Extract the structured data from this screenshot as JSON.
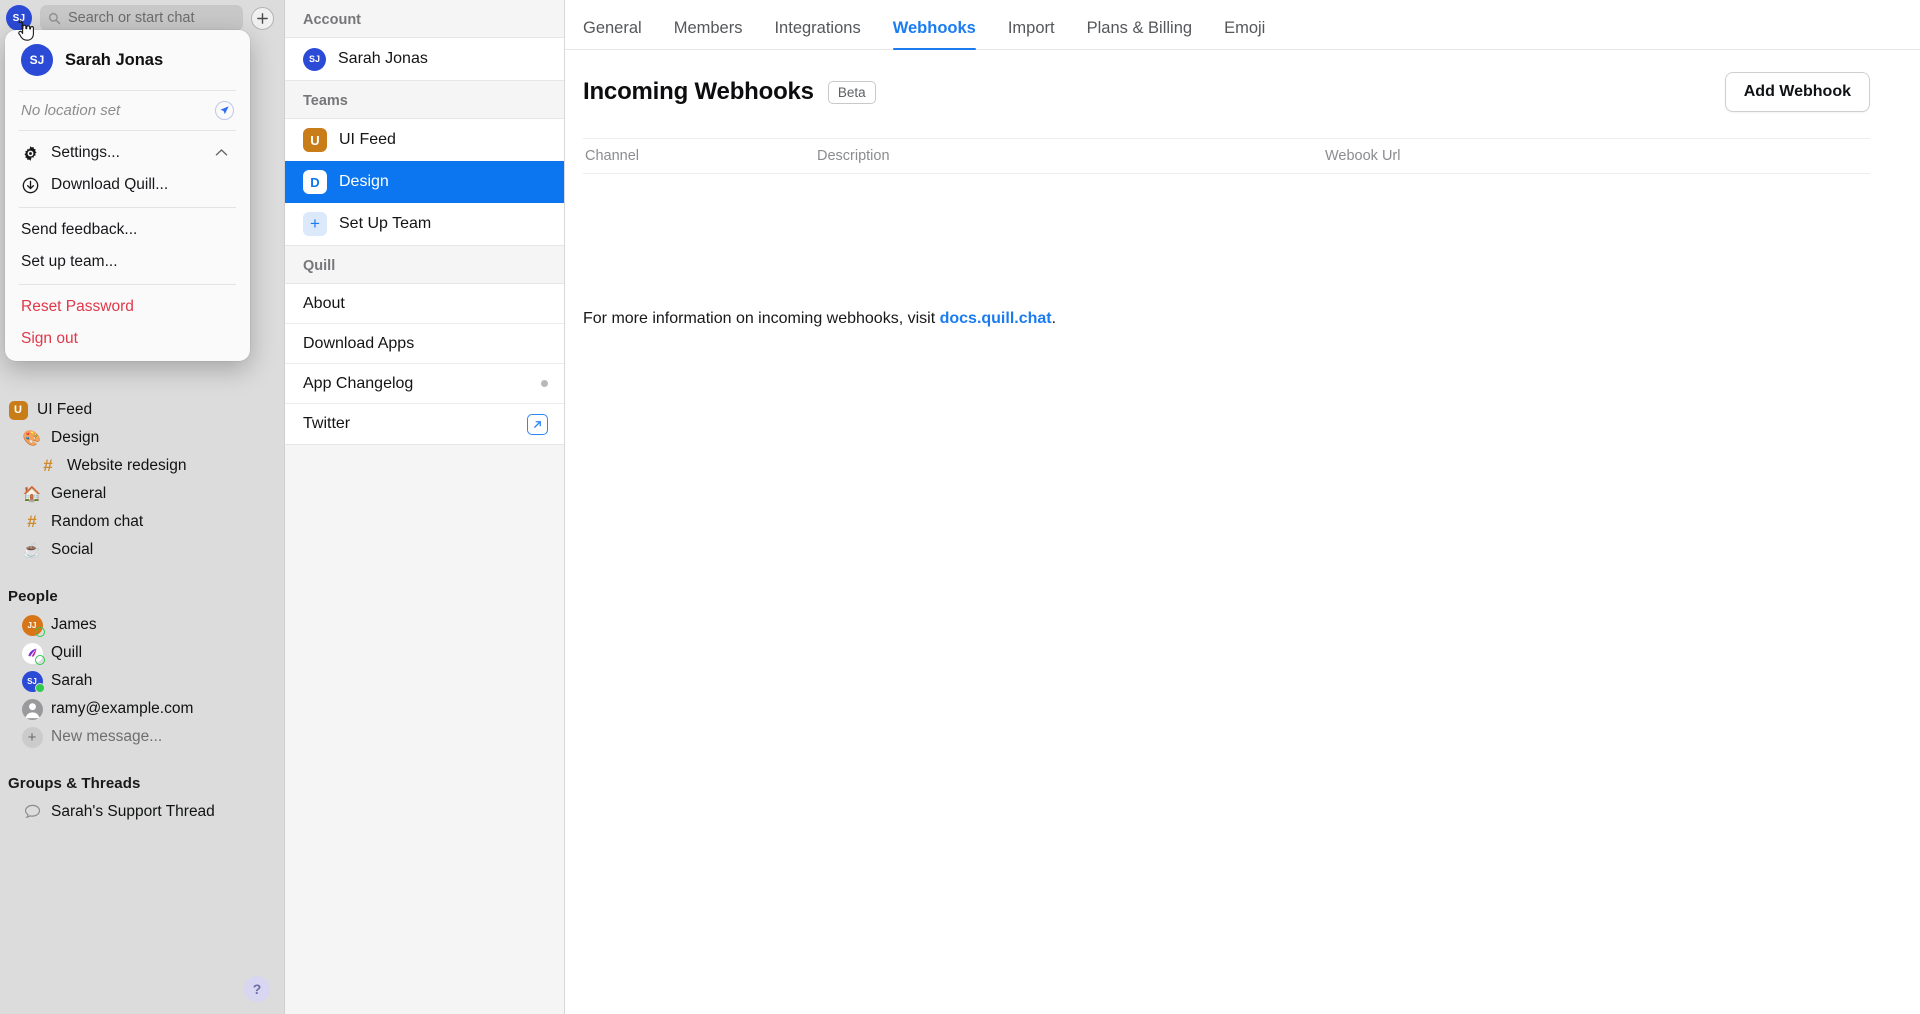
{
  "sidebar": {
    "avatar_initials": "SJ",
    "search": {
      "placeholder": "Search or start chat",
      "icon": "search-icon"
    },
    "new_chat_icon": "plus-icon",
    "teams": [
      {
        "label": "UI Feed",
        "badge": "U",
        "kind": "team"
      },
      {
        "label": "Design",
        "icon": "palette",
        "kind": "channel",
        "indent": 1
      },
      {
        "label": "Website redesign",
        "icon": "hash",
        "kind": "channel",
        "indent": 2
      },
      {
        "label": "General",
        "icon": "house",
        "kind": "channel",
        "indent": 1
      },
      {
        "label": "Random chat",
        "icon": "hash",
        "kind": "channel",
        "indent": 1
      },
      {
        "label": "Social",
        "icon": "cup",
        "kind": "channel",
        "indent": 1
      }
    ],
    "people_title": "People",
    "people": [
      {
        "label": "James",
        "initials": "JJ",
        "color": "#d87518",
        "status": "idle"
      },
      {
        "label": "Quill",
        "initials": "",
        "color": "#ffffff",
        "status": "idle",
        "logo": true
      },
      {
        "label": "Sarah",
        "initials": "SJ",
        "color": "#2b4ad6",
        "status": "online"
      },
      {
        "label": "ramy@example.com",
        "initials": "",
        "color": "#9a9a9d",
        "status": "none",
        "generic": true
      },
      {
        "label": "New message...",
        "icon": "plus-circle",
        "muted": true
      }
    ],
    "groups_title": "Groups & Threads",
    "groups": [
      {
        "label": "Sarah's Support Thread",
        "icon": "speech-bubble"
      }
    ],
    "help_label": "?"
  },
  "account_menu": {
    "name": "Sarah Jonas",
    "avatar_initials": "SJ",
    "location_text": "No location set",
    "location_icon": "navigation-arrow-icon",
    "items": [
      {
        "label": "Settings...",
        "icon": "gear-icon",
        "chevron": true
      },
      {
        "label": "Download Quill...",
        "icon": "download-icon"
      },
      {
        "label": "Send feedback..."
      },
      {
        "label": "Set up team..."
      },
      {
        "label": "Reset Password",
        "danger": true
      },
      {
        "label": "Sign out",
        "danger": true
      }
    ]
  },
  "settings_nav": {
    "account_title": "Account",
    "account_item": {
      "label": "Sarah Jonas",
      "initials": "SJ"
    },
    "teams_title": "Teams",
    "teams": [
      {
        "label": "UI Feed",
        "badge": "U",
        "badge_style": "orange",
        "active": false
      },
      {
        "label": "Design",
        "badge": "D",
        "badge_style": "white",
        "active": true
      },
      {
        "label": "Set Up Team",
        "badge": "+",
        "badge_style": "lightblue",
        "active": false
      }
    ],
    "quill_title": "Quill",
    "quill_items": [
      {
        "label": "About"
      },
      {
        "label": "Download Apps"
      },
      {
        "label": "App Changelog",
        "dot": true
      },
      {
        "label": "Twitter",
        "external": true
      }
    ]
  },
  "main": {
    "tabs": [
      {
        "label": "General",
        "active": false
      },
      {
        "label": "Members",
        "active": false
      },
      {
        "label": "Integrations",
        "active": false
      },
      {
        "label": "Webhooks",
        "active": true
      },
      {
        "label": "Import",
        "active": false
      },
      {
        "label": "Plans & Billing",
        "active": false
      },
      {
        "label": "Emoji",
        "active": false
      }
    ],
    "page_title": "Incoming Webhooks",
    "beta_badge": "Beta",
    "add_button": "Add Webhook",
    "table": {
      "columns": [
        "Channel",
        "Description",
        "Webook Url"
      ],
      "rows": []
    },
    "footer_prefix": "For more information on incoming webhooks, visit ",
    "footer_link": "docs.quill.chat",
    "footer_suffix": "."
  },
  "colors": {
    "accent_blue": "#1a7cf0",
    "selected_blue": "#0b76ef",
    "danger_red": "#e0384a",
    "team_orange": "#c87d19",
    "sidebar_bg": "#dcdcdc"
  }
}
